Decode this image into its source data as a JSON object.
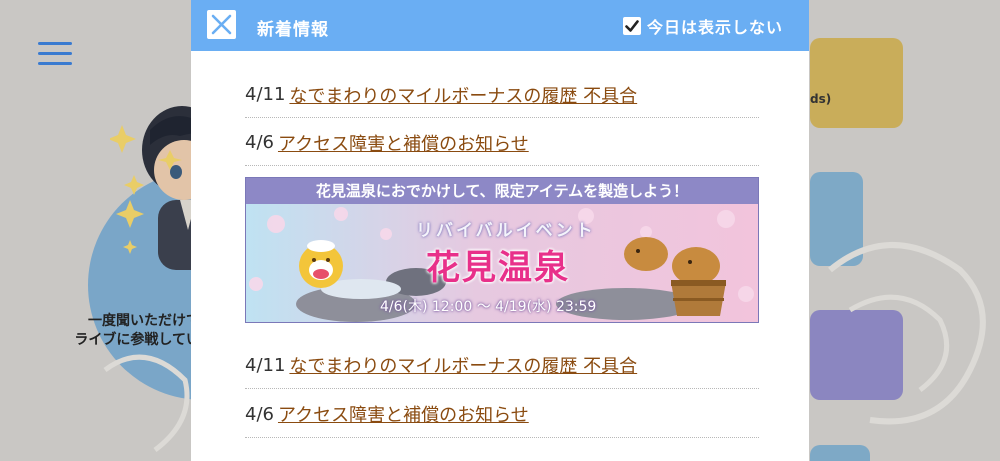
{
  "modal": {
    "title": "新着情報",
    "hide_today_label": "今日は表示しない",
    "hide_today_checked": true
  },
  "news": [
    {
      "date": "4/11",
      "title": "なでまわりのマイルボーナスの履歴 不具合"
    },
    {
      "date": "4/6",
      "title": "アクセス障害と補償のお知らせ"
    }
  ],
  "banner": {
    "headline": "花見温泉におでかけして、限定アイテムを製造しよう！",
    "subtitle": "リバイバルイベント",
    "title": "花見温泉",
    "period": "4/6(木) 12:00 〜 4/19(水) 23:59"
  },
  "news_bottom": [
    {
      "date": "4/11",
      "title": "なでまわりのマイルボーナスの履歴 不具合"
    },
    {
      "date": "4/6",
      "title": "アクセス障害と補償のお知らせ"
    }
  ],
  "background": {
    "caption_lines": [
      "一度聞いただけで",
      "ライブに参戦してい"
    ],
    "card_text": "ds)"
  },
  "colors": {
    "header": "#6aaef3",
    "link": "#8a4b10",
    "banner_title": "#e8308a",
    "banner_head": "#8d88c6"
  },
  "icons": {
    "close": "close-icon",
    "check": "check-icon",
    "menu": "hamburger-menu-icon"
  }
}
